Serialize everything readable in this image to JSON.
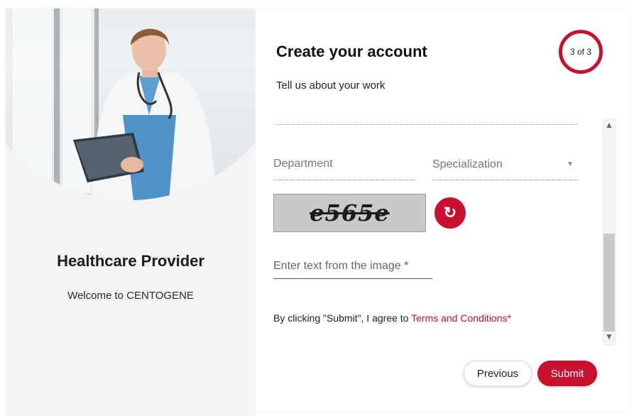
{
  "brand": {
    "accent": "#c8102e"
  },
  "left_panel": {
    "title": "Healthcare Provider",
    "welcome": "Welcome to CENTOGENE",
    "image": "doctor-with-tablet-photo"
  },
  "form": {
    "title": "Create your account",
    "subtitle": "Tell us about your work",
    "step": "3 of 3",
    "department_placeholder": "Department",
    "specialization_placeholder": "Specialization",
    "captcha_text": "e565e",
    "captcha_input_placeholder": "Enter text from the image *",
    "agree_prefix": "By clicking \"Submit\", I agree to ",
    "terms_link": "Terms and Conditions*",
    "icons": {
      "refresh": "refresh-icon",
      "dropdown": "chevron-down-icon"
    }
  },
  "buttons": {
    "previous": "Previous",
    "submit": "Submit"
  },
  "scrollbar": {
    "up": "▲",
    "down": "▼"
  }
}
